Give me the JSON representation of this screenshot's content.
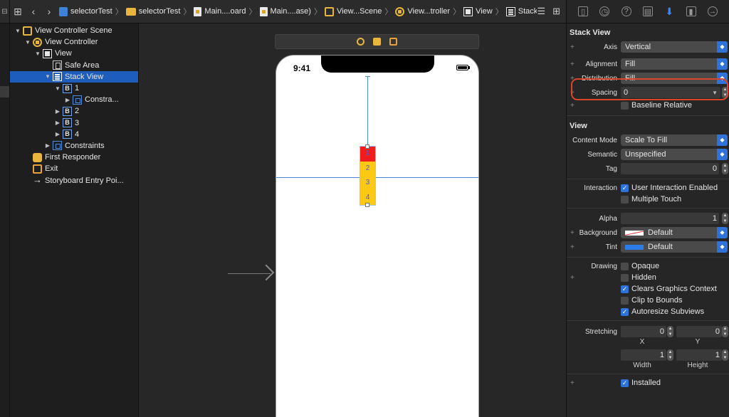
{
  "jumpbar": {
    "crumbs": [
      "selectorTest",
      "selectorTest",
      "Main....oard",
      "Main....ase)",
      "View...Scene",
      "View...troller",
      "View",
      "Stack View"
    ]
  },
  "outline": {
    "items": [
      {
        "label": "View Controller Scene",
        "icon": "scene-icon",
        "indent": 0,
        "expanded": true
      },
      {
        "label": "View Controller",
        "icon": "view-controller-icon",
        "indent": 1,
        "expanded": true
      },
      {
        "label": "View",
        "icon": "view-icon",
        "indent": 2,
        "expanded": true
      },
      {
        "label": "Safe Area",
        "icon": "safe-area-icon",
        "indent": 3,
        "expanded": null
      },
      {
        "label": "Stack View",
        "icon": "stack-view-icon",
        "indent": 3,
        "expanded": true,
        "selected": true
      },
      {
        "label": "1",
        "icon": "button-icon",
        "indent": 4,
        "expanded": true
      },
      {
        "label": "Constra...",
        "icon": "constraints-icon",
        "indent": 5,
        "expanded": false
      },
      {
        "label": "2",
        "icon": "button-icon",
        "indent": 4,
        "expanded": false
      },
      {
        "label": "3",
        "icon": "button-icon",
        "indent": 4,
        "expanded": false
      },
      {
        "label": "4",
        "icon": "button-icon",
        "indent": 4,
        "expanded": false
      },
      {
        "label": "Constraints",
        "icon": "constraints-icon",
        "indent": 3,
        "expanded": false
      },
      {
        "label": "First Responder",
        "icon": "first-responder-icon",
        "indent": 1,
        "expanded": null
      },
      {
        "label": "Exit",
        "icon": "exit-icon",
        "indent": 1,
        "expanded": null
      },
      {
        "label": "Storyboard Entry Poi...",
        "icon": "entry-arrow-icon",
        "indent": 1,
        "expanded": null
      }
    ]
  },
  "canvas": {
    "status_time": "9:41",
    "stack_labels": [
      "1",
      "2",
      "3",
      "4"
    ]
  },
  "inspector": {
    "stack_view_title": "Stack View",
    "axis": {
      "label": "Axis",
      "value": "Vertical"
    },
    "alignment": {
      "label": "Alignment",
      "value": "Fill"
    },
    "distribution": {
      "label": "Distribution",
      "value": "Fill"
    },
    "spacing": {
      "label": "Spacing",
      "value": "0"
    },
    "baseline": {
      "label": "Baseline Relative"
    },
    "view_title": "View",
    "content_mode": {
      "label": "Content Mode",
      "value": "Scale To Fill"
    },
    "semantic": {
      "label": "Semantic",
      "value": "Unspecified"
    },
    "tag": {
      "label": "Tag",
      "value": "0"
    },
    "interaction": {
      "label": "Interaction",
      "user": "User Interaction Enabled",
      "multi": "Multiple Touch"
    },
    "alpha": {
      "label": "Alpha",
      "value": "1"
    },
    "background": {
      "label": "Background",
      "value": "Default"
    },
    "tint": {
      "label": "Tint",
      "value": "Default"
    },
    "drawing": {
      "label": "Drawing",
      "opaque": "Opaque",
      "hidden": "Hidden",
      "clears": "Clears Graphics Context",
      "clip": "Clip to Bounds",
      "autoresize": "Autoresize Subviews"
    },
    "stretching": {
      "label": "Stretching",
      "x": "0",
      "y": "0",
      "width": "1",
      "height": "1",
      "x_label": "X",
      "y_label": "Y",
      "w_label": "Width",
      "h_label": "Height"
    },
    "installed": {
      "label": "Installed"
    }
  },
  "colors": {
    "accent": "#2f72da",
    "selection": "#1e5dbc",
    "highlight_ring": "#d9462c",
    "stack_red": "#f21c1c",
    "stack_yellow": "#fbc913"
  }
}
